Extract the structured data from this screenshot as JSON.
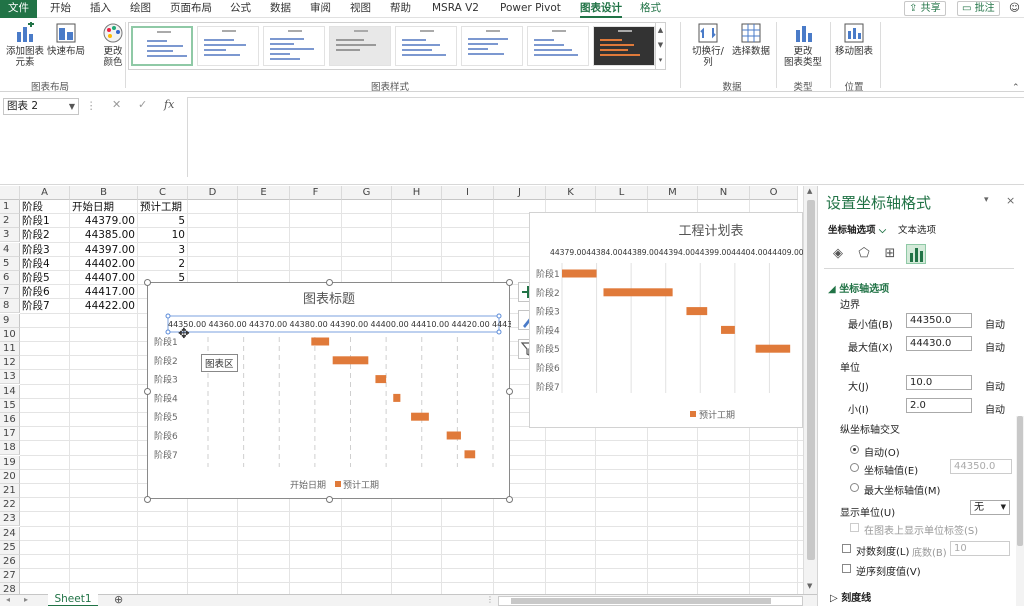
{
  "tabs": [
    "文件",
    "开始",
    "插入",
    "绘图",
    "页面布局",
    "公式",
    "数据",
    "审阅",
    "视图",
    "帮助",
    "MSRA V2",
    "Power Pivot",
    "图表设计",
    "格式"
  ],
  "active_tab": "图表设计",
  "top_right": {
    "share": "共享",
    "comments": "批注",
    "emoji": "☺"
  },
  "ribbon": {
    "add_element": "添加图表\n元素",
    "quick_layout": "快速布局",
    "change_color": "更改\n颜色",
    "group_layout": "图表布局",
    "group_styles": "图表样式",
    "switch_row_col": "切换行/列",
    "select_data": "选择数据",
    "group_data": "数据",
    "change_type": "更改\n图表类型",
    "group_type": "类型",
    "move_chart": "移动图表",
    "group_location": "位置"
  },
  "formula_bar": {
    "name_box": "图表 2",
    "cancel": "✕",
    "enter": "✓",
    "fx": "fx",
    "value": ""
  },
  "columns": [
    "A",
    "B",
    "C",
    "D",
    "E",
    "F",
    "G",
    "H",
    "I",
    "J",
    "K",
    "L",
    "M",
    "N",
    "O"
  ],
  "rows": [
    "1",
    "2",
    "3",
    "4",
    "5",
    "6",
    "7",
    "8",
    "9",
    "10",
    "11",
    "12",
    "13",
    "14",
    "15",
    "16",
    "17",
    "18",
    "19",
    "20",
    "21",
    "22",
    "23",
    "24",
    "25",
    "26",
    "27",
    "28"
  ],
  "table": {
    "headers": [
      "阶段",
      "开始日期",
      "预计工期"
    ],
    "rows": [
      [
        "阶段1",
        "44379.00",
        "5"
      ],
      [
        "阶段2",
        "44385.00",
        "10"
      ],
      [
        "阶段3",
        "44397.00",
        "3"
      ],
      [
        "阶段4",
        "44402.00",
        "2"
      ],
      [
        "阶段5",
        "44407.00",
        "5"
      ],
      [
        "阶段6",
        "44417.00",
        "4"
      ],
      [
        "阶段7",
        "44422.00",
        "3"
      ]
    ]
  },
  "chart_data": [
    {
      "type": "bar",
      "title": "图表标题",
      "categories": [
        "阶段1",
        "阶段2",
        "阶段3",
        "阶段4",
        "阶段5",
        "阶段6",
        "阶段7"
      ],
      "series": [
        {
          "name": "开始日期",
          "values": [
            44379,
            44385,
            44397,
            44402,
            44407,
            44417,
            44422
          ],
          "color": "none"
        },
        {
          "name": "预计工期",
          "values": [
            5,
            10,
            3,
            2,
            5,
            4,
            3
          ],
          "color": "#e07a3a"
        }
      ],
      "stacked": true,
      "x_ticks": [
        "44350.00",
        "44360.00",
        "44370.00",
        "44380.00",
        "44390.00",
        "44400.00",
        "44410.00",
        "44420.00",
        "44430.00"
      ],
      "xlim": [
        44350,
        44430
      ],
      "grid": "vertical-dashed",
      "legend": "bottom",
      "tooltip": "图表区"
    },
    {
      "type": "bar",
      "title": "工程计划表",
      "categories": [
        "阶段1",
        "阶段2",
        "阶段3",
        "阶段4",
        "阶段5",
        "阶段6",
        "阶段7"
      ],
      "series": [
        {
          "name": "开始日期",
          "values": [
            44379,
            44385,
            44397,
            44402,
            44407,
            44417,
            44422
          ],
          "color": "none"
        },
        {
          "name": "预计工期",
          "values": [
            5,
            10,
            3,
            2,
            5,
            4,
            3
          ],
          "color": "#e07a3a"
        }
      ],
      "stacked": true,
      "x_ticks_text": "44379.0044384.0044389.0044394.0044399.0044404.0044409.00444",
      "xlim": [
        44379,
        44414
      ],
      "grid": "vertical",
      "legend": "bottom",
      "legend_label": "预计工期"
    }
  ],
  "pane": {
    "title": "设置坐标轴格式",
    "tab_axis": "坐标轴选项",
    "tab_text": "文本选项",
    "section": "坐标轴选项",
    "bounds": "边界",
    "min_label": "最小值(B)",
    "min_value": "44350.0",
    "min_auto": "自动",
    "max_label": "最大值(X)",
    "max_value": "44430.0",
    "max_auto": "自动",
    "units": "单位",
    "major_label": "大(J)",
    "major_value": "10.0",
    "major_auto": "自动",
    "minor_label": "小(I)",
    "minor_value": "2.0",
    "minor_auto": "自动",
    "cross": "纵坐标轴交叉",
    "cross_auto": "自动(O)",
    "cross_value_label": "坐标轴值(E)",
    "cross_value": "44350.0",
    "cross_max": "最大坐标轴值(M)",
    "display_units": "显示单位(U)",
    "display_units_value": "无",
    "show_units_label": "在图表上显示单位标签(S)",
    "log_label": "对数刻度(L)",
    "base_label": "底数(B)",
    "base_value": "10",
    "reverse_label": "逆序刻度值(V)",
    "ticks": "刻度线"
  },
  "sheet_tab": "Sheet1",
  "colors": {
    "accent": "#217346",
    "bar": "#e07a3a"
  }
}
